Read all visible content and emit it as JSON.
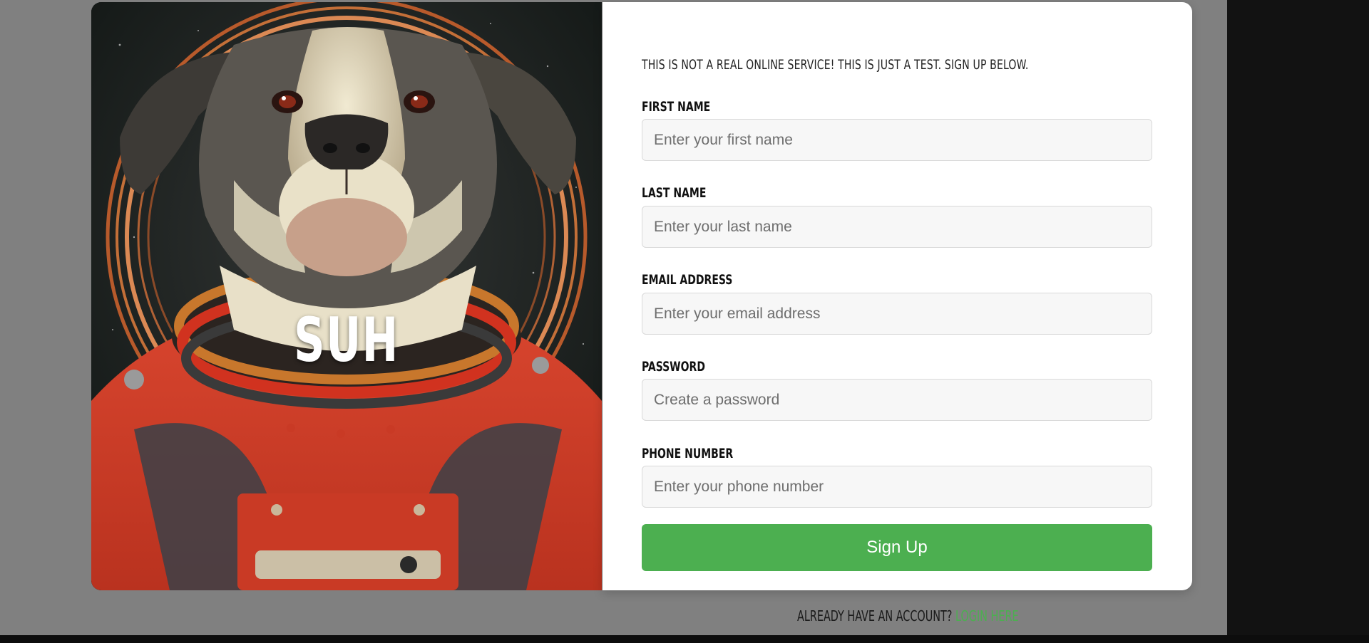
{
  "hero": {
    "overlay_text": "SUH",
    "image_subject": "dog-astronaut-portrait"
  },
  "form": {
    "notice": "This is not a real online service! This is just a test. Sign up below.",
    "fields": [
      {
        "label": "First Name",
        "placeholder": "Enter your first name",
        "value": ""
      },
      {
        "label": "Last Name",
        "placeholder": "Enter your last name",
        "value": ""
      },
      {
        "label": "Email Address",
        "placeholder": "Enter your email address",
        "value": ""
      },
      {
        "label": "Password",
        "placeholder": "Create a password",
        "value": ""
      },
      {
        "label": "Phone Number",
        "placeholder": "Enter your phone number",
        "value": ""
      }
    ],
    "submit_label": "Sign Up"
  },
  "footer": {
    "prompt": "Already have an account?",
    "link_label": "Login here"
  },
  "colors": {
    "accent": "#4caf50",
    "backdrop": "#808080",
    "card": "#ffffff"
  }
}
